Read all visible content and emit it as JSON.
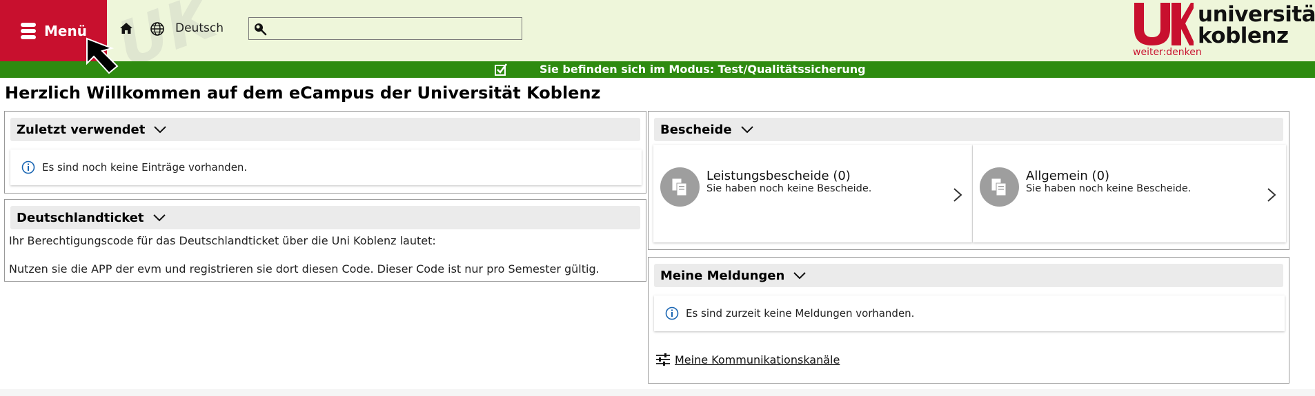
{
  "header": {
    "menu_label": "Menü",
    "language": "Deutsch",
    "search_value": "",
    "logo_line1": "universität",
    "logo_line2": "koblenz",
    "logo_slogan": "weiter:denken",
    "brand_color": "#c8102e",
    "header_bg": "#eef6da"
  },
  "mode_bar": {
    "text": "Sie befinden sich im Modus: Test/Qualitätssicherung",
    "color": "#2e8b10"
  },
  "page_title": "Herzlich Willkommen auf dem eCampus der Universität Koblenz",
  "recent": {
    "title": "Zuletzt verwendet",
    "empty_text": "Es sind noch keine Einträge vorhanden."
  },
  "ticket": {
    "title": "Deutschlandticket",
    "line1": "Ihr Berechtigungscode für das Deutschlandticket über die Uni Koblenz lautet:",
    "line2": "Nutzen sie die APP der evm und registrieren sie dort diesen Code. Dieser Code ist nur pro Semester gültig."
  },
  "bescheide": {
    "title": "Bescheide",
    "tiles": [
      {
        "title": "Leistungsbescheide (0)",
        "subtitle": "Sie haben noch keine Bescheide."
      },
      {
        "title": "Allgemein (0)",
        "subtitle": "Sie haben noch keine Bescheide."
      }
    ]
  },
  "meldungen": {
    "title": "Meine Meldungen",
    "empty_text": "Es sind zurzeit keine Meldungen vorhanden.",
    "link_label": "Meine Kommunikationskanäle"
  },
  "icons": [
    "menu-icon",
    "home-icon",
    "globe-icon",
    "search-icon",
    "check-icon",
    "chevron-down-icon",
    "info-icon",
    "document-icon",
    "chevron-right-icon",
    "sliders-icon",
    "cursor-arrow-icon"
  ]
}
